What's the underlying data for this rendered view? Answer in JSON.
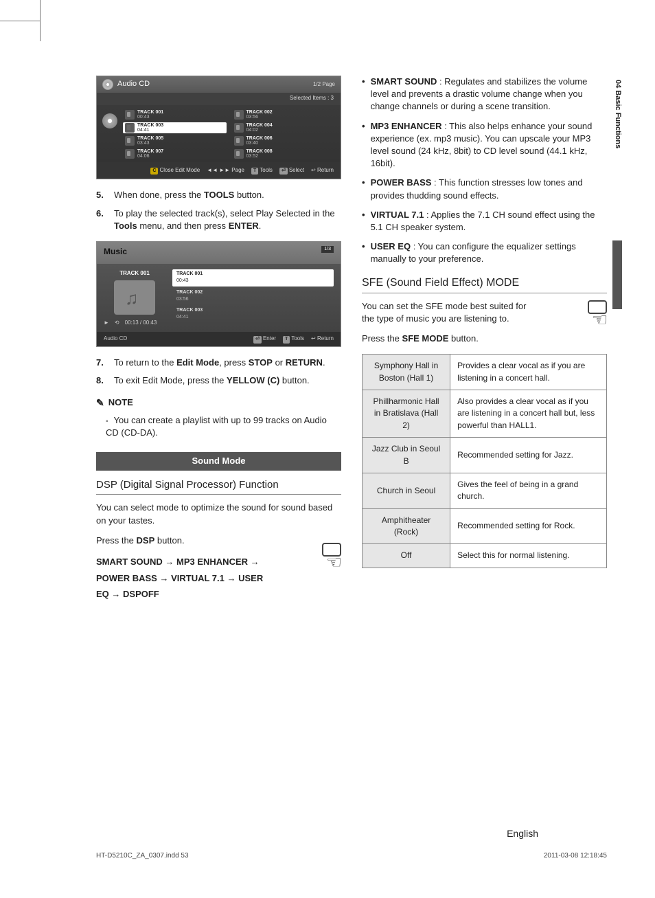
{
  "sideLabel": "04  Basic Functions",
  "audioCd": {
    "title": "Audio CD",
    "page": "1/2 Page",
    "selected": "Selected Items : 3",
    "tracks": [
      {
        "name": "TRACK 001",
        "time": "00:43",
        "sel": false
      },
      {
        "name": "TRACK 002",
        "time": "03:56",
        "sel": false
      },
      {
        "name": "TRACK 003",
        "time": "04:41",
        "sel": true
      },
      {
        "name": "TRACK 004",
        "time": "04:02",
        "sel": false
      },
      {
        "name": "TRACK 005",
        "time": "03:43",
        "sel": false
      },
      {
        "name": "TRACK 006",
        "time": "03:40",
        "sel": false
      },
      {
        "name": "TRACK 007",
        "time": "04:06",
        "sel": false
      },
      {
        "name": "TRACK 008",
        "time": "03:52",
        "sel": false
      }
    ],
    "footer": {
      "close": "Close Edit Mode",
      "page": "Page",
      "tools": "Tools",
      "select": "Select",
      "return": "Return"
    }
  },
  "steps56": [
    {
      "n": "5.",
      "html": "When done, press the <b>TOOLS</b> button."
    },
    {
      "n": "6.",
      "html": "To play the selected track(s), select Play Selected in the <b>Tools</b> menu, and then press <b>ENTER</b>."
    }
  ],
  "music": {
    "title": "Music",
    "page": "1/3",
    "current": "TRACK 001",
    "time": "00:13 / 00:43",
    "sub": "Audio CD",
    "list": [
      {
        "name": "TRACK 001",
        "time": "00:43",
        "sel": true
      },
      {
        "name": "TRACK 002",
        "time": "03:56",
        "sel": false
      },
      {
        "name": "TRACK 003",
        "time": "04:41",
        "sel": false
      }
    ],
    "footer": {
      "enter": "Enter",
      "tools": "Tools",
      "return": "Return"
    }
  },
  "steps78": [
    {
      "n": "7.",
      "html": "To return to the <b>Edit Mode</b>, press <b>STOP</b> or <b>RETURN</b>."
    },
    {
      "n": "8.",
      "html": "To exit Edit Mode, press the <b>YELLOW (C)</b> button."
    }
  ],
  "noteHead": "NOTE",
  "note": "You can create a playlist with up to 99 tracks on Audio CD (CD-DA).",
  "soundModeBar": "Sound Mode",
  "dspHead": "DSP (Digital Signal Processor) Function",
  "dspPara": "You can select mode to optimize the sound for sound based on your tastes.",
  "dspPress": "Press the <b>DSP</b> button.",
  "dspSeq": "SMART SOUND → MP3 ENHANCER → POWER BASS →  VIRTUAL 7.1 → USER EQ → DSPOFF",
  "features": [
    {
      "b": "SMART SOUND",
      "t": " : Regulates and stabilizes the volume level and prevents a drastic volume change when you change channels or during a scene transition."
    },
    {
      "b": "MP3 ENHANCER",
      "t": " : This also helps enhance your sound experience (ex. mp3 music). You can upscale your MP3 level sound (24 kHz, 8bit) to CD level sound (44.1 kHz, 16bit)."
    },
    {
      "b": "POWER BASS",
      "t": " : This function stresses low tones and provides thudding sound effects."
    },
    {
      "b": "VIRTUAL 7.1",
      "t": " : Applies the 7.1 CH sound effect using the 5.1 CH speaker system."
    },
    {
      "b": "USER EQ",
      "t": " : You can configure the equalizer settings manually to your preference."
    }
  ],
  "sfeHead": "SFE (Sound Field Effect) MODE",
  "sfePara": "You can set the SFE mode best suited for the type of music you are listening to.",
  "sfePress": "Press the <b>SFE MODE</b> button.",
  "sfeTable": [
    {
      "l": "Symphony Hall in Boston (Hall 1)",
      "r": "Provides a clear vocal as if you are listening in a concert hall."
    },
    {
      "l": "Phillharmonic Hall in Bratislava (Hall 2)",
      "r": "Also provides a clear vocal as if you are listening in a concert hall but, less powerful than HALL1."
    },
    {
      "l": "Jazz Club in Seoul B",
      "r": "Recommended setting for Jazz."
    },
    {
      "l": "Church in Seoul",
      "r": "Gives the feel of being in a grand church."
    },
    {
      "l": "Amphitheater (Rock)",
      "r": "Recommended setting for Rock."
    },
    {
      "l": "Off",
      "r": "Select this for normal listening."
    }
  ],
  "lang": "English",
  "footer": {
    "left": "HT-D5210C_ZA_0307.indd   53",
    "right": "2011-03-08    12:18:45"
  }
}
